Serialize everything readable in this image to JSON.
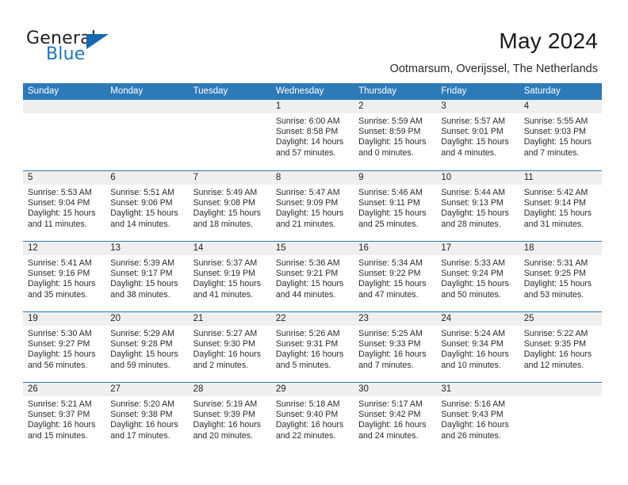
{
  "logo": {
    "word_top": "General",
    "word_bottom": "Blue",
    "triangle_color": "#1668b0",
    "blue_color": "#1d76bf"
  },
  "header": {
    "title": "May 2024",
    "subtitle": "Ootmarsum, Overijssel, The Netherlands"
  },
  "theme": {
    "header_blue": "#2e7ab8",
    "day_band_gray": "#efefef"
  },
  "weekday_headers": [
    "Sunday",
    "Monday",
    "Tuesday",
    "Wednesday",
    "Thursday",
    "Friday",
    "Saturday"
  ],
  "weeks": [
    [
      {
        "day": "",
        "sunrise": "",
        "sunset": "",
        "daylight_line1": "",
        "daylight_line2": ""
      },
      {
        "day": "",
        "sunrise": "",
        "sunset": "",
        "daylight_line1": "",
        "daylight_line2": ""
      },
      {
        "day": "",
        "sunrise": "",
        "sunset": "",
        "daylight_line1": "",
        "daylight_line2": ""
      },
      {
        "day": "1",
        "sunrise": "Sunrise: 6:00 AM",
        "sunset": "Sunset: 8:58 PM",
        "daylight_line1": "Daylight: 14 hours",
        "daylight_line2": "and 57 minutes."
      },
      {
        "day": "2",
        "sunrise": "Sunrise: 5:59 AM",
        "sunset": "Sunset: 8:59 PM",
        "daylight_line1": "Daylight: 15 hours",
        "daylight_line2": "and 0 minutes."
      },
      {
        "day": "3",
        "sunrise": "Sunrise: 5:57 AM",
        "sunset": "Sunset: 9:01 PM",
        "daylight_line1": "Daylight: 15 hours",
        "daylight_line2": "and 4 minutes."
      },
      {
        "day": "4",
        "sunrise": "Sunrise: 5:55 AM",
        "sunset": "Sunset: 9:03 PM",
        "daylight_line1": "Daylight: 15 hours",
        "daylight_line2": "and 7 minutes."
      }
    ],
    [
      {
        "day": "5",
        "sunrise": "Sunrise: 5:53 AM",
        "sunset": "Sunset: 9:04 PM",
        "daylight_line1": "Daylight: 15 hours",
        "daylight_line2": "and 11 minutes."
      },
      {
        "day": "6",
        "sunrise": "Sunrise: 5:51 AM",
        "sunset": "Sunset: 9:06 PM",
        "daylight_line1": "Daylight: 15 hours",
        "daylight_line2": "and 14 minutes."
      },
      {
        "day": "7",
        "sunrise": "Sunrise: 5:49 AM",
        "sunset": "Sunset: 9:08 PM",
        "daylight_line1": "Daylight: 15 hours",
        "daylight_line2": "and 18 minutes."
      },
      {
        "day": "8",
        "sunrise": "Sunrise: 5:47 AM",
        "sunset": "Sunset: 9:09 PM",
        "daylight_line1": "Daylight: 15 hours",
        "daylight_line2": "and 21 minutes."
      },
      {
        "day": "9",
        "sunrise": "Sunrise: 5:46 AM",
        "sunset": "Sunset: 9:11 PM",
        "daylight_line1": "Daylight: 15 hours",
        "daylight_line2": "and 25 minutes."
      },
      {
        "day": "10",
        "sunrise": "Sunrise: 5:44 AM",
        "sunset": "Sunset: 9:13 PM",
        "daylight_line1": "Daylight: 15 hours",
        "daylight_line2": "and 28 minutes."
      },
      {
        "day": "11",
        "sunrise": "Sunrise: 5:42 AM",
        "sunset": "Sunset: 9:14 PM",
        "daylight_line1": "Daylight: 15 hours",
        "daylight_line2": "and 31 minutes."
      }
    ],
    [
      {
        "day": "12",
        "sunrise": "Sunrise: 5:41 AM",
        "sunset": "Sunset: 9:16 PM",
        "daylight_line1": "Daylight: 15 hours",
        "daylight_line2": "and 35 minutes."
      },
      {
        "day": "13",
        "sunrise": "Sunrise: 5:39 AM",
        "sunset": "Sunset: 9:17 PM",
        "daylight_line1": "Daylight: 15 hours",
        "daylight_line2": "and 38 minutes."
      },
      {
        "day": "14",
        "sunrise": "Sunrise: 5:37 AM",
        "sunset": "Sunset: 9:19 PM",
        "daylight_line1": "Daylight: 15 hours",
        "daylight_line2": "and 41 minutes."
      },
      {
        "day": "15",
        "sunrise": "Sunrise: 5:36 AM",
        "sunset": "Sunset: 9:21 PM",
        "daylight_line1": "Daylight: 15 hours",
        "daylight_line2": "and 44 minutes."
      },
      {
        "day": "16",
        "sunrise": "Sunrise: 5:34 AM",
        "sunset": "Sunset: 9:22 PM",
        "daylight_line1": "Daylight: 15 hours",
        "daylight_line2": "and 47 minutes."
      },
      {
        "day": "17",
        "sunrise": "Sunrise: 5:33 AM",
        "sunset": "Sunset: 9:24 PM",
        "daylight_line1": "Daylight: 15 hours",
        "daylight_line2": "and 50 minutes."
      },
      {
        "day": "18",
        "sunrise": "Sunrise: 5:31 AM",
        "sunset": "Sunset: 9:25 PM",
        "daylight_line1": "Daylight: 15 hours",
        "daylight_line2": "and 53 minutes."
      }
    ],
    [
      {
        "day": "19",
        "sunrise": "Sunrise: 5:30 AM",
        "sunset": "Sunset: 9:27 PM",
        "daylight_line1": "Daylight: 15 hours",
        "daylight_line2": "and 56 minutes."
      },
      {
        "day": "20",
        "sunrise": "Sunrise: 5:29 AM",
        "sunset": "Sunset: 9:28 PM",
        "daylight_line1": "Daylight: 15 hours",
        "daylight_line2": "and 59 minutes."
      },
      {
        "day": "21",
        "sunrise": "Sunrise: 5:27 AM",
        "sunset": "Sunset: 9:30 PM",
        "daylight_line1": "Daylight: 16 hours",
        "daylight_line2": "and 2 minutes."
      },
      {
        "day": "22",
        "sunrise": "Sunrise: 5:26 AM",
        "sunset": "Sunset: 9:31 PM",
        "daylight_line1": "Daylight: 16 hours",
        "daylight_line2": "and 5 minutes."
      },
      {
        "day": "23",
        "sunrise": "Sunrise: 5:25 AM",
        "sunset": "Sunset: 9:33 PM",
        "daylight_line1": "Daylight: 16 hours",
        "daylight_line2": "and 7 minutes."
      },
      {
        "day": "24",
        "sunrise": "Sunrise: 5:24 AM",
        "sunset": "Sunset: 9:34 PM",
        "daylight_line1": "Daylight: 16 hours",
        "daylight_line2": "and 10 minutes."
      },
      {
        "day": "25",
        "sunrise": "Sunrise: 5:22 AM",
        "sunset": "Sunset: 9:35 PM",
        "daylight_line1": "Daylight: 16 hours",
        "daylight_line2": "and 12 minutes."
      }
    ],
    [
      {
        "day": "26",
        "sunrise": "Sunrise: 5:21 AM",
        "sunset": "Sunset: 9:37 PM",
        "daylight_line1": "Daylight: 16 hours",
        "daylight_line2": "and 15 minutes."
      },
      {
        "day": "27",
        "sunrise": "Sunrise: 5:20 AM",
        "sunset": "Sunset: 9:38 PM",
        "daylight_line1": "Daylight: 16 hours",
        "daylight_line2": "and 17 minutes."
      },
      {
        "day": "28",
        "sunrise": "Sunrise: 5:19 AM",
        "sunset": "Sunset: 9:39 PM",
        "daylight_line1": "Daylight: 16 hours",
        "daylight_line2": "and 20 minutes."
      },
      {
        "day": "29",
        "sunrise": "Sunrise: 5:18 AM",
        "sunset": "Sunset: 9:40 PM",
        "daylight_line1": "Daylight: 16 hours",
        "daylight_line2": "and 22 minutes."
      },
      {
        "day": "30",
        "sunrise": "Sunrise: 5:17 AM",
        "sunset": "Sunset: 9:42 PM",
        "daylight_line1": "Daylight: 16 hours",
        "daylight_line2": "and 24 minutes."
      },
      {
        "day": "31",
        "sunrise": "Sunrise: 5:16 AM",
        "sunset": "Sunset: 9:43 PM",
        "daylight_line1": "Daylight: 16 hours",
        "daylight_line2": "and 26 minutes."
      },
      {
        "day": "",
        "sunrise": "",
        "sunset": "",
        "daylight_line1": "",
        "daylight_line2": ""
      }
    ]
  ]
}
